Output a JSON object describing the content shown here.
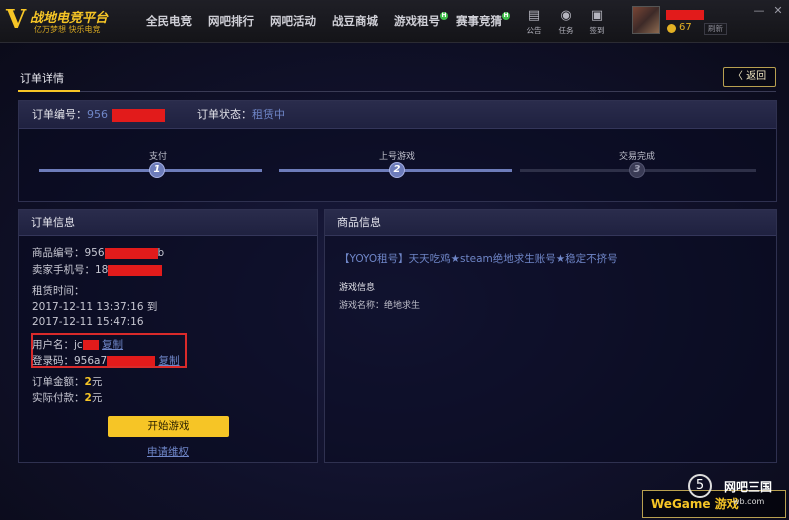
{
  "app": {
    "logo_title": "战地电竞平台",
    "logo_slogan": "亿万梦想  快乐电竞"
  },
  "nav": {
    "items": [
      {
        "label": "全民电竞",
        "badge": ""
      },
      {
        "label": "网吧排行",
        "badge": ""
      },
      {
        "label": "网吧活动",
        "badge": ""
      },
      {
        "label": "战豆商城",
        "badge": ""
      },
      {
        "label": "游戏租号",
        "badge": "H"
      },
      {
        "label": "赛事竞猜",
        "badge": "H"
      }
    ]
  },
  "tools": {
    "notice_label": "公告",
    "task_label": "任务",
    "checkin_label": "签到"
  },
  "user": {
    "coins": "67",
    "refresh_label": "刷新"
  },
  "window": {
    "minimize": "—",
    "close": "✕"
  },
  "page": {
    "tab_title": "订单详情",
    "back_label": "〈 返回"
  },
  "order_status": {
    "id_label": "订单编号：",
    "id_value": "956",
    "status_label": "订单状态：",
    "status_value": "租赁中"
  },
  "progress": {
    "steps": [
      {
        "label": "支付",
        "num": "1",
        "state": "done"
      },
      {
        "label": "上号游戏",
        "num": "2",
        "state": "done"
      },
      {
        "label": "交易完成",
        "num": "3",
        "state": "todo"
      }
    ]
  },
  "order_info": {
    "title": "订单信息",
    "product_id_label": "商品编号：",
    "product_id_value": "956",
    "product_id_tail": "b",
    "seller_phone_label": "卖家手机号：",
    "seller_phone_value": "18",
    "rent_time_label": "租赁时间：",
    "rent_start": "2017-12-11 13:37:16",
    "rent_to": "到",
    "rent_end": "2017-12-11 15:47:16",
    "username_label": "用户名：",
    "username_value": "jc",
    "login_code_label": "登录码：",
    "login_code_value": "956a7",
    "copy_label": "复制",
    "amount_label": "订单金额：",
    "amount_value": "2",
    "paid_label": "实际付款：",
    "paid_value": "2",
    "currency": "元",
    "start_button": "开始游戏",
    "appeal_link": "申请维权"
  },
  "product_info": {
    "title": "商品信息",
    "product_title": "【YOYO租号】天天吃鸡★steam绝地求生账号★稳定不挤号",
    "game_info_heading": "游戏信息",
    "game_name_label": "游戏名称：",
    "game_name_value": "绝地求生"
  },
  "watermark": {
    "wegame": "WeGame",
    "wegame_tail": "游戏",
    "site_text": "网吧三国",
    "site_url": "wb.com"
  },
  "colors": {
    "accent_yellow": "#f6c526",
    "link_blue": "#6f86c8",
    "redaction_red": "#e21b1b"
  }
}
